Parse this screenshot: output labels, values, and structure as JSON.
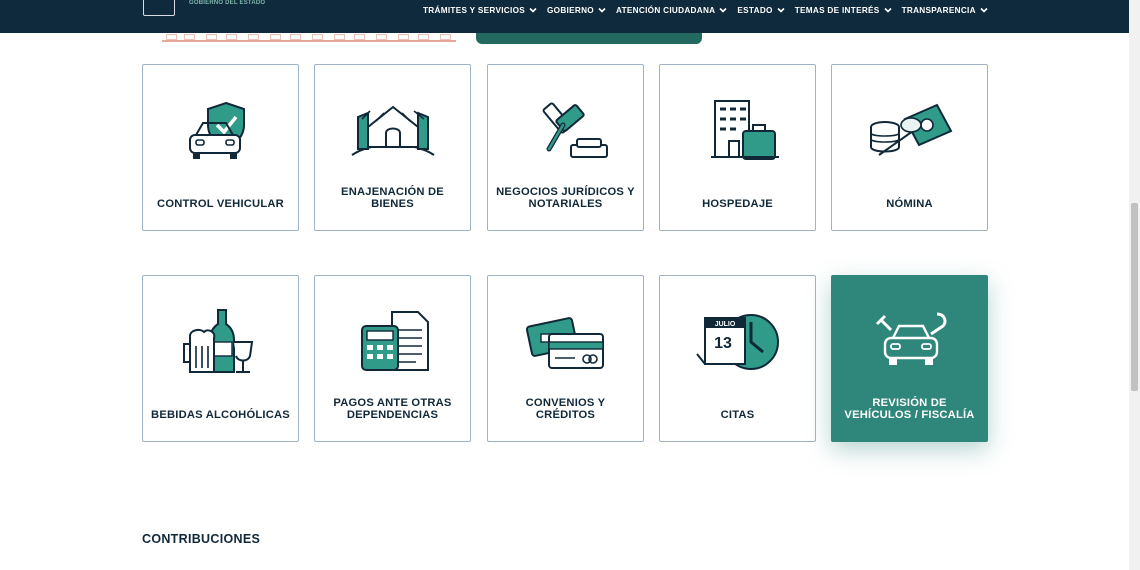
{
  "header": {
    "logo_text": "GOBIERNO DEL ESTADO",
    "nav": [
      {
        "label": "TRÁMITES Y SERVICIOS"
      },
      {
        "label": "GOBIERNO"
      },
      {
        "label": "ATENCIÓN CIUDADANA"
      },
      {
        "label": "ESTADO"
      },
      {
        "label": "TEMAS DE INTERÉS"
      },
      {
        "label": "TRANSPARENCIA"
      }
    ]
  },
  "cards": [
    {
      "label": "CONTROL VEHICULAR",
      "icon": "car-shield-icon"
    },
    {
      "label": "ENAJENACIÓN DE BIENES",
      "icon": "building-icon"
    },
    {
      "label": "NEGOCIOS JURÍDICOS Y NOTARIALES",
      "icon": "gavel-icon"
    },
    {
      "label": "HOSPEDAJE",
      "icon": "hotel-luggage-icon"
    },
    {
      "label": "NÓMINA",
      "icon": "money-icon"
    },
    {
      "label": "BEBIDAS ALCOHÓLICAS",
      "icon": "drinks-icon"
    },
    {
      "label": "PAGOS ANTE OTRAS DEPENDENCIAS",
      "icon": "calculator-document-icon"
    },
    {
      "label": "CONVENIOS Y CRÉDITOS",
      "icon": "credit-cards-icon"
    },
    {
      "label": "CITAS",
      "icon": "calendar-clock-icon",
      "calendar_month": "JULIO",
      "calendar_day": "13"
    },
    {
      "label": "REVISIÓN DE VEHÍCULOS / FISCALÍA",
      "icon": "car-tools-icon",
      "active": true
    }
  ],
  "section": {
    "title": "CONTRIBUCIONES"
  },
  "colors": {
    "nav_bg": "#0f2a3c",
    "accent": "#2f867a",
    "text": "#102838",
    "border": "#9fb3c6"
  }
}
